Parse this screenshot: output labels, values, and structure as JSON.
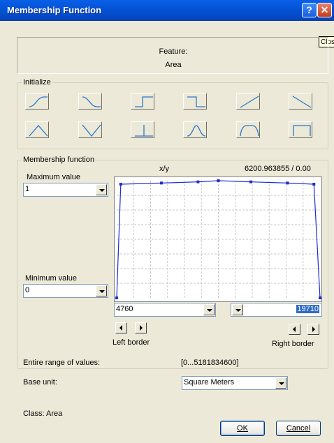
{
  "window": {
    "title": "Membership Function",
    "help_glyph": "?",
    "close_glyph": "✕",
    "tooltip": "Close"
  },
  "feature": {
    "label": "Feature:",
    "value": "Area"
  },
  "initialize": {
    "label": "Initialize",
    "buttons": [
      "s-curve-rising",
      "s-curve-falling",
      "step-up",
      "step-down",
      "linear-rising",
      "linear-falling",
      "triangle",
      "v-shape",
      "singleton",
      "gaussian",
      "trapezoid",
      "rectangle"
    ]
  },
  "membership": {
    "label": "Membership function",
    "max": {
      "label": "Maximum value",
      "value": "1"
    },
    "min": {
      "label": "Minimum value",
      "value": "0"
    },
    "graph_header": {
      "xy_label": "x/y",
      "readout": "6200.963855 / 0.00"
    },
    "left_border": {
      "value": "4760",
      "label": "Left border"
    },
    "right_border": {
      "value": "19710",
      "label": "Right border"
    },
    "curve_y": [
      0,
      0.97,
      0.98,
      0.99,
      1.0,
      0.99,
      0.98,
      0.97,
      0
    ]
  },
  "range": {
    "label": "Entire range of values:",
    "value": "[0...5181834600]"
  },
  "base_unit": {
    "label": "Base unit:",
    "value": "Square Meters"
  },
  "class_label": "Class: Area",
  "buttons": {
    "ok": "OK",
    "cancel": "Cancel"
  }
}
